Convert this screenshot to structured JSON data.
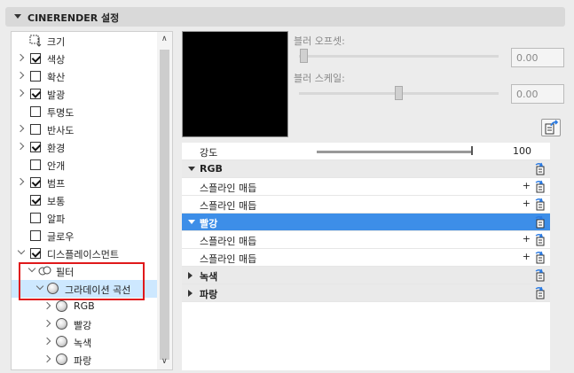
{
  "panel_title": "CINERENDER 설정",
  "tree": [
    {
      "label": "크기",
      "icon": "size-icon",
      "checked": null,
      "expandable": false
    },
    {
      "label": "색상",
      "checked": true,
      "expandable": true
    },
    {
      "label": "확산",
      "checked": false,
      "expandable": true
    },
    {
      "label": "발광",
      "checked": true,
      "expandable": true
    },
    {
      "label": "투명도",
      "checked": false,
      "expandable": false
    },
    {
      "label": "반사도",
      "checked": false,
      "expandable": true
    },
    {
      "label": "환경",
      "checked": true,
      "expandable": true
    },
    {
      "label": "안개",
      "checked": false,
      "expandable": false
    },
    {
      "label": "범프",
      "checked": true,
      "expandable": true
    },
    {
      "label": "보통",
      "checked": true,
      "expandable": false
    },
    {
      "label": "알파",
      "checked": false,
      "expandable": false
    },
    {
      "label": "글로우",
      "checked": false,
      "expandable": false
    },
    {
      "label": "디스플레이스먼트",
      "checked": true,
      "expandable": true,
      "expanded": true
    },
    {
      "label": "필터",
      "icon": "filter-icon",
      "expandable": true,
      "expanded": true
    },
    {
      "label": "그라데이션 곡선",
      "icon": "sphere-icon",
      "expandable": true,
      "expanded": true,
      "selected": true
    },
    {
      "label": "RGB",
      "icon": "sphere-icon",
      "expandable": true
    },
    {
      "label": "빨강",
      "icon": "sphere-icon",
      "expandable": true
    },
    {
      "label": "녹색",
      "icon": "sphere-icon",
      "expandable": true
    },
    {
      "label": "파랑",
      "icon": "sphere-icon",
      "expandable": true
    }
  ],
  "blur_offset": {
    "label": "블러 오프셋:",
    "value": "0.00"
  },
  "blur_scale": {
    "label": "블러 스케일:",
    "value": "0.00"
  },
  "strength": {
    "label": "강도",
    "value": "100"
  },
  "curves": [
    {
      "type": "group",
      "label": "RGB",
      "expanded": true
    },
    {
      "type": "item",
      "label": "스플라인 매듭"
    },
    {
      "type": "item",
      "label": "스플라인 매듭"
    },
    {
      "type": "group",
      "label": "빨강",
      "expanded": true,
      "highlighted": true
    },
    {
      "type": "item",
      "label": "스플라인 매듭"
    },
    {
      "type": "item",
      "label": "스플라인 매듭"
    },
    {
      "type": "group",
      "label": "녹색",
      "expanded": false
    },
    {
      "type": "group",
      "label": "파랑",
      "expanded": false
    }
  ],
  "plus_symbol": "+",
  "colors": {
    "highlight": "#3d8ee8",
    "selection": "#cde8ff",
    "annotation": "#e0191b"
  }
}
